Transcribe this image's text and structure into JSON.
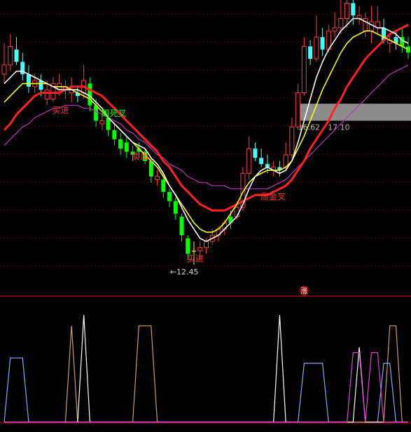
{
  "chart_data": [
    {
      "type": "candlestick",
      "title": "",
      "grid": true,
      "colors": {
        "up": "#ff3c3c",
        "down": "#44ffff",
        "down_alt": "#00ff00",
        "ma_fast": "#ffffff",
        "ma_mid": "#ffff00",
        "ma_slow": "#ff2020",
        "ma_long": "#c030c0",
        "grid": "#6a0000",
        "divider": "#c01010",
        "band": "#8c8c8c"
      },
      "ylim": [
        11.5,
        21.0
      ],
      "x_count": 67,
      "candles": [
        {
          "o": 18.6,
          "h": 19.6,
          "l": 18.3,
          "c": 18.9,
          "col": "up"
        },
        {
          "o": 18.9,
          "h": 19.9,
          "l": 18.7,
          "c": 19.5,
          "col": "up"
        },
        {
          "o": 19.4,
          "h": 19.8,
          "l": 18.9,
          "c": 19.0,
          "col": "down"
        },
        {
          "o": 19.0,
          "h": 19.3,
          "l": 18.4,
          "c": 18.6,
          "col": "down"
        },
        {
          "o": 18.6,
          "h": 18.9,
          "l": 18.0,
          "c": 18.2,
          "col": "down"
        },
        {
          "o": 18.2,
          "h": 18.6,
          "l": 18.0,
          "c": 18.4,
          "col": "up"
        },
        {
          "o": 18.4,
          "h": 18.6,
          "l": 17.9,
          "c": 18.1,
          "col": "down"
        },
        {
          "o": 18.1,
          "h": 18.4,
          "l": 17.6,
          "c": 17.8,
          "col": "up"
        },
        {
          "o": 17.8,
          "h": 18.5,
          "l": 17.7,
          "c": 18.3,
          "col": "up"
        },
        {
          "o": 18.3,
          "h": 18.6,
          "l": 17.9,
          "c": 18.1,
          "col": "up"
        },
        {
          "o": 18.1,
          "h": 18.4,
          "l": 17.8,
          "c": 18.2,
          "col": "up"
        },
        {
          "o": 18.1,
          "h": 18.5,
          "l": 17.7,
          "c": 18.0,
          "col": "up"
        },
        {
          "o": 18.0,
          "h": 18.2,
          "l": 17.7,
          "c": 17.9,
          "col": "down"
        },
        {
          "o": 18.0,
          "h": 18.9,
          "l": 17.8,
          "c": 18.4,
          "col": "up"
        },
        {
          "o": 18.3,
          "h": 18.5,
          "l": 17.4,
          "c": 17.6,
          "col": "down_alt"
        },
        {
          "o": 17.6,
          "h": 17.8,
          "l": 16.9,
          "c": 17.1,
          "col": "down_alt"
        },
        {
          "o": 17.1,
          "h": 17.4,
          "l": 16.8,
          "c": 17.0,
          "col": "up"
        },
        {
          "o": 17.2,
          "h": 17.3,
          "l": 16.6,
          "c": 16.8,
          "col": "down_alt"
        },
        {
          "o": 16.8,
          "h": 17.0,
          "l": 16.3,
          "c": 16.5,
          "col": "down_alt"
        },
        {
          "o": 16.5,
          "h": 16.7,
          "l": 16.0,
          "c": 16.2,
          "col": "down_alt"
        },
        {
          "o": 16.4,
          "h": 16.6,
          "l": 15.9,
          "c": 16.1,
          "col": "down_alt"
        },
        {
          "o": 16.1,
          "h": 16.3,
          "l": 15.8,
          "c": 16.0,
          "col": "down_alt"
        },
        {
          "o": 16.2,
          "h": 16.4,
          "l": 15.9,
          "c": 16.1,
          "col": "down_alt"
        },
        {
          "o": 16.1,
          "h": 16.2,
          "l": 15.7,
          "c": 15.8,
          "col": "down_alt"
        },
        {
          "o": 15.8,
          "h": 15.9,
          "l": 15.1,
          "c": 15.3,
          "col": "down_alt"
        },
        {
          "o": 15.3,
          "h": 15.5,
          "l": 15.0,
          "c": 15.2,
          "col": "up"
        },
        {
          "o": 15.2,
          "h": 15.3,
          "l": 14.6,
          "c": 14.8,
          "col": "down_alt"
        },
        {
          "o": 14.8,
          "h": 14.9,
          "l": 14.3,
          "c": 14.5,
          "col": "down_alt"
        },
        {
          "o": 14.5,
          "h": 14.6,
          "l": 13.9,
          "c": 14.1,
          "col": "down_alt"
        },
        {
          "o": 14.0,
          "h": 14.1,
          "l": 13.2,
          "c": 13.4,
          "col": "down_alt"
        },
        {
          "o": 13.3,
          "h": 13.4,
          "l": 12.6,
          "c": 12.8,
          "col": "down_alt"
        },
        {
          "o": 12.9,
          "h": 13.2,
          "l": 12.45,
          "c": 12.9,
          "col": "yellow"
        },
        {
          "o": 12.9,
          "h": 13.2,
          "l": 12.6,
          "c": 13.0,
          "col": "up"
        },
        {
          "o": 13.0,
          "h": 13.3,
          "l": 12.8,
          "c": 13.2,
          "col": "up"
        },
        {
          "o": 13.2,
          "h": 13.6,
          "l": 13.1,
          "c": 13.4,
          "col": "up"
        },
        {
          "o": 13.4,
          "h": 13.7,
          "l": 13.2,
          "c": 13.6,
          "col": "up"
        },
        {
          "o": 13.6,
          "h": 13.9,
          "l": 13.4,
          "c": 13.8,
          "col": "up"
        },
        {
          "o": 13.8,
          "h": 14.2,
          "l": 13.6,
          "c": 14.0,
          "col": "down_alt"
        },
        {
          "o": 14.0,
          "h": 14.5,
          "l": 13.9,
          "c": 14.3,
          "col": "up"
        },
        {
          "o": 14.3,
          "h": 15.6,
          "l": 14.2,
          "c": 15.4,
          "col": "up"
        },
        {
          "o": 15.4,
          "h": 16.6,
          "l": 15.2,
          "c": 16.2,
          "col": "up"
        },
        {
          "o": 16.2,
          "h": 16.4,
          "l": 15.8,
          "c": 15.9,
          "col": "down"
        },
        {
          "o": 15.9,
          "h": 16.2,
          "l": 15.6,
          "c": 15.7,
          "col": "down"
        },
        {
          "o": 15.7,
          "h": 16.0,
          "l": 15.4,
          "c": 15.6,
          "col": "down"
        },
        {
          "o": 15.6,
          "h": 15.8,
          "l": 15.3,
          "c": 15.5,
          "col": "up"
        },
        {
          "o": 15.5,
          "h": 15.8,
          "l": 15.3,
          "c": 15.6,
          "col": "down"
        },
        {
          "o": 15.6,
          "h": 16.4,
          "l": 15.5,
          "c": 16.0,
          "col": "up"
        },
        {
          "o": 16.0,
          "h": 17.2,
          "l": 15.9,
          "c": 16.9,
          "col": "up"
        },
        {
          "o": 16.9,
          "h": 18.3,
          "l": 16.8,
          "c": 18.0,
          "col": "up"
        },
        {
          "o": 18.0,
          "h": 19.8,
          "l": 17.9,
          "c": 19.5,
          "col": "up"
        },
        {
          "o": 19.5,
          "h": 19.7,
          "l": 18.9,
          "c": 19.1,
          "col": "down"
        },
        {
          "o": 19.1,
          "h": 20.5,
          "l": 19.0,
          "c": 19.8,
          "col": "up"
        },
        {
          "o": 19.8,
          "h": 20.1,
          "l": 19.2,
          "c": 19.4,
          "col": "down"
        },
        {
          "o": 19.4,
          "h": 20.2,
          "l": 19.3,
          "c": 20.0,
          "col": "up"
        },
        {
          "o": 20.0,
          "h": 20.6,
          "l": 19.8,
          "c": 20.1,
          "col": "up"
        },
        {
          "o": 20.1,
          "h": 21.0,
          "l": 19.9,
          "c": 20.4,
          "col": "up"
        },
        {
          "o": 20.4,
          "h": 21.0,
          "l": 20.1,
          "c": 20.9,
          "col": "up"
        },
        {
          "o": 20.9,
          "h": 21.0,
          "l": 20.2,
          "c": 20.5,
          "col": "down"
        },
        {
          "o": 20.5,
          "h": 20.8,
          "l": 20.2,
          "c": 20.4,
          "col": "up"
        },
        {
          "o": 20.4,
          "h": 20.6,
          "l": 19.8,
          "c": 20.0,
          "col": "up"
        },
        {
          "o": 20.0,
          "h": 20.8,
          "l": 19.6,
          "c": 20.3,
          "col": "up"
        },
        {
          "o": 20.3,
          "h": 20.8,
          "l": 19.9,
          "c": 20.1,
          "col": "up"
        },
        {
          "o": 20.1,
          "h": 20.4,
          "l": 19.6,
          "c": 19.7,
          "col": "down"
        },
        {
          "o": 19.7,
          "h": 19.9,
          "l": 19.3,
          "c": 19.6,
          "col": "up"
        },
        {
          "o": 19.6,
          "h": 20.0,
          "l": 19.4,
          "c": 19.8,
          "col": "down"
        },
        {
          "o": 19.8,
          "h": 20.1,
          "l": 19.3,
          "c": 19.5,
          "col": "down_alt"
        },
        {
          "o": 19.5,
          "h": 19.8,
          "l": 19.1,
          "c": 19.3,
          "col": "down_alt"
        }
      ],
      "ma_fast": [
        18.3,
        18.5,
        18.7,
        18.7,
        18.6,
        18.5,
        18.4,
        18.3,
        18.2,
        18.1,
        18.1,
        18.1,
        18.1,
        18.0,
        17.9,
        17.7,
        17.5,
        17.2,
        17.0,
        16.8,
        16.6,
        16.4,
        16.3,
        16.2,
        15.9,
        15.7,
        15.4,
        15.0,
        14.7,
        14.3,
        13.9,
        13.6,
        13.3,
        13.2,
        13.3,
        13.4,
        13.6,
        13.8,
        14.0,
        14.4,
        14.9,
        15.3,
        15.5,
        15.6,
        15.5,
        15.4,
        15.5,
        15.8,
        16.4,
        17.1,
        17.8,
        18.5,
        19.0,
        19.4,
        19.7,
        20.0,
        20.2,
        20.4,
        20.4,
        20.3,
        20.2,
        20.1,
        20.1,
        20.0,
        19.9,
        19.7,
        19.6
      ],
      "ma_mid": [
        17.7,
        17.9,
        18.1,
        18.3,
        18.3,
        18.3,
        18.3,
        18.3,
        18.2,
        18.2,
        18.2,
        18.1,
        18.0,
        17.9,
        17.8,
        17.6,
        17.4,
        17.2,
        17.0,
        16.8,
        16.6,
        16.4,
        16.2,
        16.0,
        15.8,
        15.6,
        15.3,
        15.0,
        14.7,
        14.4,
        14.1,
        13.8,
        13.6,
        13.5,
        13.5,
        13.6,
        13.8,
        14.1,
        14.4,
        14.8,
        15.1,
        15.3,
        15.4,
        15.5,
        15.5,
        15.5,
        15.6,
        15.8,
        16.2,
        16.6,
        17.1,
        17.6,
        18.1,
        18.5,
        18.9,
        19.3,
        19.6,
        19.8,
        19.9,
        20.0,
        20.0,
        19.9,
        19.8,
        19.7,
        19.6,
        19.5,
        19.4
      ],
      "ma_slow": [
        16.8,
        17.0,
        17.3,
        17.5,
        17.7,
        17.9,
        18.0,
        18.0,
        18.0,
        18.0,
        18.1,
        18.2,
        18.2,
        18.2,
        18.1,
        18.0,
        17.9,
        17.7,
        17.5,
        17.3,
        17.1,
        16.9,
        16.7,
        16.5,
        16.3,
        16.1,
        15.8,
        15.6,
        15.3,
        15.0,
        14.8,
        14.6,
        14.4,
        14.3,
        14.2,
        14.2,
        14.2,
        14.3,
        14.4,
        14.5,
        14.6,
        14.7,
        14.7,
        14.7,
        14.8,
        14.9,
        15.0,
        15.2,
        15.5,
        15.8,
        16.2,
        16.5,
        16.8,
        17.1,
        17.5,
        17.8,
        18.2,
        18.5,
        18.8,
        19.1,
        19.3,
        19.5,
        19.7,
        19.9,
        20.0,
        20.1,
        20.2
      ],
      "ma_long": [
        16.3,
        16.5,
        16.7,
        16.9,
        17.0,
        17.2,
        17.3,
        17.4,
        17.5,
        17.5,
        17.6,
        17.6,
        17.6,
        17.5,
        17.5,
        17.4,
        17.3,
        17.2,
        17.1,
        17.0,
        16.8,
        16.7,
        16.5,
        16.4,
        16.2,
        16.0,
        15.9,
        15.7,
        15.6,
        15.5,
        15.3,
        15.2,
        15.1,
        15.1,
        15.0,
        15.0,
        15.0,
        14.9,
        14.9,
        14.9,
        14.9,
        14.9,
        14.9,
        14.9,
        15.0,
        15.1,
        15.2,
        15.4,
        15.6,
        15.8,
        16.0,
        16.2,
        16.4,
        16.6,
        16.8,
        17.0,
        17.2,
        17.4,
        17.6,
        17.8,
        18.0,
        18.2,
        18.4,
        18.6,
        18.7,
        18.8,
        18.9
      ],
      "band": {
        "low": 17.1,
        "high": 17.65,
        "start_index": 48,
        "label": "16.62 - 17.10"
      },
      "annotations": [
        {
          "text": "买进",
          "i": 9,
          "y": 17.35,
          "color": "#ff3030"
        },
        {
          "text": "周死叉",
          "i": 17,
          "y": 17.25,
          "color": "#00ff00"
        },
        {
          "text": "卖出",
          "i": 22,
          "y": 15.85,
          "color": "#ff3030"
        },
        {
          "text": "周金叉",
          "i": 43,
          "y": 14.55,
          "color": "#ff3030"
        },
        {
          "text": "买进",
          "i": 31,
          "y": 12.55,
          "color": "#ff3030"
        }
      ],
      "low_marker": {
        "text": "←12.45",
        "i": 28,
        "y": 12.45
      },
      "badge": {
        "text": "涨",
        "i": 49
      }
    },
    {
      "type": "line",
      "ylim": [
        0,
        100
      ],
      "series": [
        {
          "color": "#8aa8ff",
          "values": [
            0,
            60,
            60,
            60,
            0,
            0,
            0,
            0,
            0,
            0,
            0,
            0,
            0,
            0,
            0,
            0,
            0,
            0,
            0,
            0,
            0,
            0,
            0,
            0,
            0,
            0,
            0,
            0,
            0,
            0,
            0,
            0,
            0,
            0,
            0,
            0,
            0,
            0,
            0,
            0,
            0,
            0,
            0,
            0,
            0,
            0,
            0,
            0,
            0,
            55,
            55,
            55,
            55,
            0,
            0,
            0,
            0,
            0,
            0,
            0,
            0,
            0,
            55,
            55,
            0,
            0,
            0
          ]
        },
        {
          "color": "#d0a060",
          "values": [
            0,
            0,
            0,
            0,
            0,
            0,
            0,
            0,
            0,
            0,
            0,
            90,
            0,
            0,
            0,
            0,
            0,
            0,
            0,
            0,
            0,
            0,
            90,
            90,
            90,
            0,
            0,
            0,
            0,
            0,
            0,
            0,
            0,
            0,
            0,
            0,
            0,
            0,
            0,
            0,
            0,
            0,
            0,
            0,
            0,
            0,
            0,
            0,
            0,
            0,
            0,
            0,
            0,
            0,
            0,
            0,
            0,
            0,
            0,
            0,
            0,
            0,
            0,
            90,
            90,
            0,
            0
          ]
        },
        {
          "color": "#ffffff",
          "values": [
            0,
            0,
            0,
            0,
            0,
            0,
            0,
            0,
            0,
            0,
            0,
            0,
            0,
            100,
            0,
            0,
            0,
            0,
            0,
            0,
            0,
            0,
            0,
            0,
            0,
            0,
            0,
            0,
            0,
            0,
            0,
            0,
            0,
            0,
            0,
            0,
            0,
            0,
            0,
            0,
            0,
            0,
            0,
            0,
            0,
            100,
            0,
            0,
            0,
            0,
            0,
            0,
            0,
            0,
            0,
            0,
            0,
            0,
            70,
            0,
            0,
            0,
            0,
            0,
            0,
            0,
            0
          ]
        },
        {
          "color": "#e040e0",
          "values": [
            0,
            0,
            0,
            0,
            0,
            0,
            0,
            0,
            0,
            0,
            0,
            0,
            0,
            0,
            0,
            0,
            0,
            0,
            0,
            0,
            0,
            0,
            0,
            0,
            0,
            0,
            0,
            0,
            0,
            0,
            0,
            0,
            0,
            0,
            0,
            0,
            0,
            0,
            0,
            0,
            0,
            0,
            0,
            0,
            0,
            0,
            0,
            0,
            0,
            0,
            0,
            0,
            0,
            0,
            0,
            0,
            0,
            65,
            65,
            0,
            65,
            65,
            0,
            0,
            0,
            0,
            0
          ]
        }
      ]
    }
  ]
}
